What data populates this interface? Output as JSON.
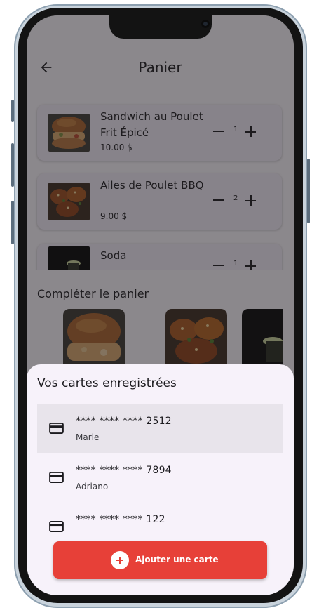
{
  "appbar": {
    "title": "Panier",
    "back_icon": "arrow-back-icon"
  },
  "cart": {
    "items": [
      {
        "name": "Sandwich au Poulet Frit Épicé",
        "price": "10.00 $",
        "quantity": "1"
      },
      {
        "name": "Ailes de Poulet BBQ",
        "price": "9.00 $",
        "quantity": "2"
      },
      {
        "name": "Soda",
        "price": "",
        "quantity": "1"
      }
    ]
  },
  "recommendations": {
    "title": "Compléter le panier"
  },
  "saved_cards": {
    "title": "Vos cartes enregistrées",
    "cards": [
      {
        "number": "**** **** **** 2512",
        "holder": "Marie",
        "selected": true
      },
      {
        "number": "**** **** **** 7894",
        "holder": "Adriano",
        "selected": false
      },
      {
        "number": "**** **** **** 122",
        "holder": "",
        "selected": false
      }
    ],
    "card_icon": "credit-card-icon",
    "add_button_label": "Ajouter une carte",
    "add_icon": "add-circle-icon"
  },
  "colors": {
    "accent": "#e74038",
    "sheet_background": "#f7f2fa",
    "card_background": "#f1ebf6",
    "selected_row": "#e8e4eb"
  }
}
